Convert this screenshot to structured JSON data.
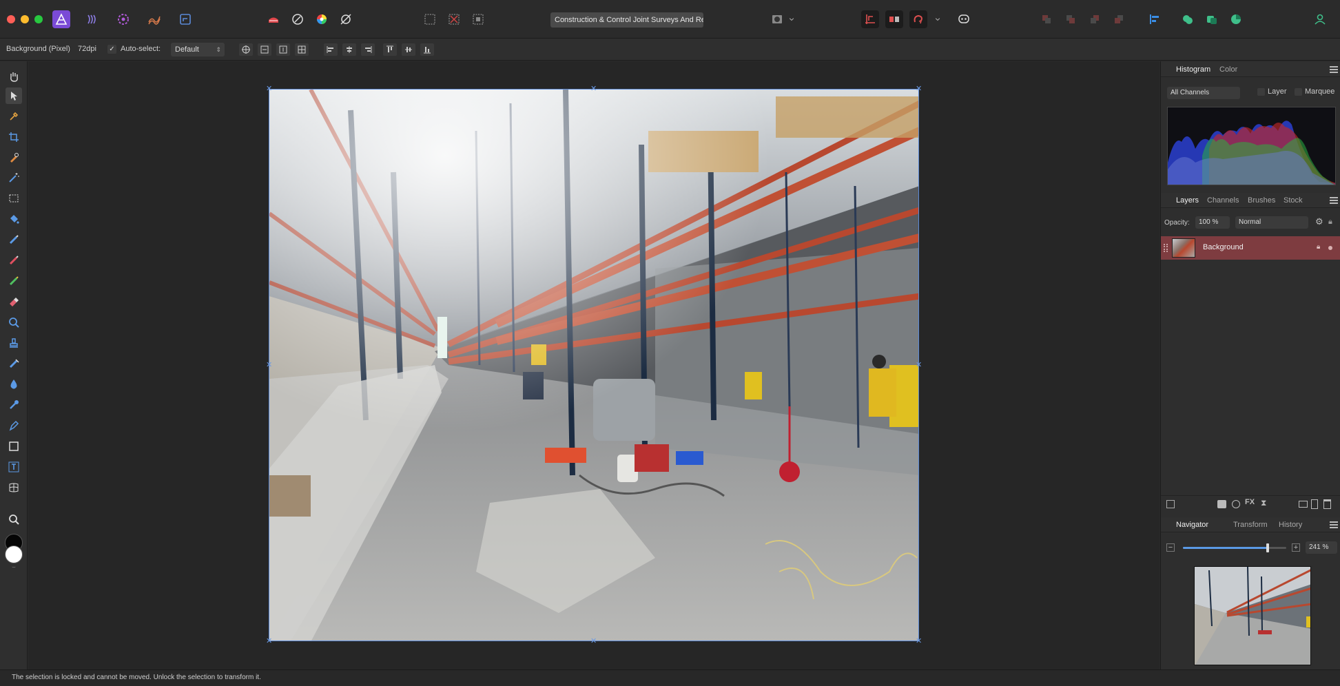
{
  "titlebar": {
    "document_title": "Construction & Control Joint Surveys And Re"
  },
  "context": {
    "layer_name": "Background (Pixel)",
    "dpi": "72dpi",
    "auto_select_label": "Auto-select:",
    "auto_select_checked": "✓",
    "auto_select_value": "Default"
  },
  "histogram_panel": {
    "tabs": [
      "Histogram",
      "Color"
    ],
    "channels": "All Channels",
    "layer_label": "Layer",
    "marquee_label": "Marquee",
    "warning": "⚠"
  },
  "layers_panel": {
    "tabs": [
      "Layers",
      "Channels",
      "Brushes",
      "Stock"
    ],
    "opacity_label": "Opacity:",
    "opacity_value": "100 %",
    "blend_mode": "Normal",
    "layers": [
      {
        "name": "Background"
      }
    ]
  },
  "navigator_panel": {
    "tabs": [
      "Navigator",
      "Transform",
      "History"
    ],
    "zoom": "241 %",
    "zoom_fraction": 0.82
  },
  "status": {
    "message": "The selection is locked and cannot be moved. Unlock the selection to transform it."
  },
  "colors": {
    "accent": "#5b8ad8",
    "layer_selected": "#7e3c40",
    "app_purple": "#7a4bd6"
  }
}
